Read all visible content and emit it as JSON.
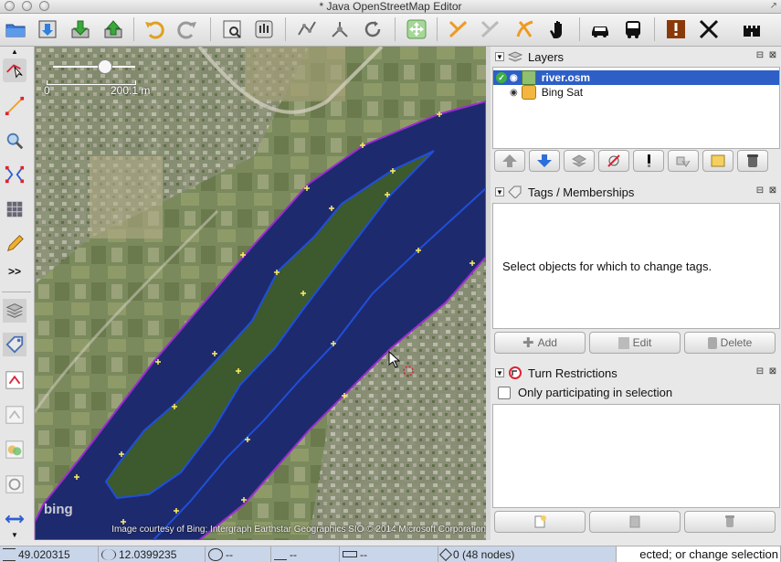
{
  "window": {
    "title": "* Java OpenStreetMap Editor"
  },
  "colors": {
    "water": "#1e2a6e",
    "selection": "#2d5fc7",
    "way": "#1f4fd8",
    "node": "#ffee66",
    "coastline": "#9b2dd1"
  },
  "toolbar": {
    "icons": [
      "open-file-icon",
      "save-icon",
      "download-icon",
      "upload-icon",
      "undo-icon",
      "redo-icon",
      "preferences-icon",
      "validate-icon",
      "wireframe-icon",
      "merge-nodes-icon",
      "refresh-icon",
      "move-icon",
      "split-way-icon",
      "combine-way-icon",
      "draw-way-icon",
      "pan-hand-icon",
      "car-icon",
      "bus-icon",
      "warning-icon",
      "tools-icon",
      "castle-icon"
    ]
  },
  "left_tools": {
    "more_label": ">>"
  },
  "map": {
    "scale_zero": "0",
    "scale_distance": "200.1 m",
    "bing_logo": "bing",
    "attribution": "Image courtesy of Bing; Intergraph Earthstar Geographics  SIO © 2014 Microsoft Corporation"
  },
  "layers": {
    "title": "Layers",
    "items": [
      {
        "name": "river.osm",
        "selected": true
      },
      {
        "name": "Bing Sat",
        "selected": false
      }
    ]
  },
  "tags": {
    "title": "Tags / Memberships",
    "empty_message": "Select objects for which to change tags.",
    "add_label": "Add",
    "edit_label": "Edit",
    "delete_label": "Delete"
  },
  "turn_restrictions": {
    "title": "Turn Restrictions",
    "checkbox_label": "Only participating in selection"
  },
  "status": {
    "lat": "49.020315",
    "lon": "12.0399235",
    "heading": "--",
    "angle": "--",
    "length": "--",
    "selection": "0 (48 nodes)",
    "help": "ected; or change selection"
  }
}
